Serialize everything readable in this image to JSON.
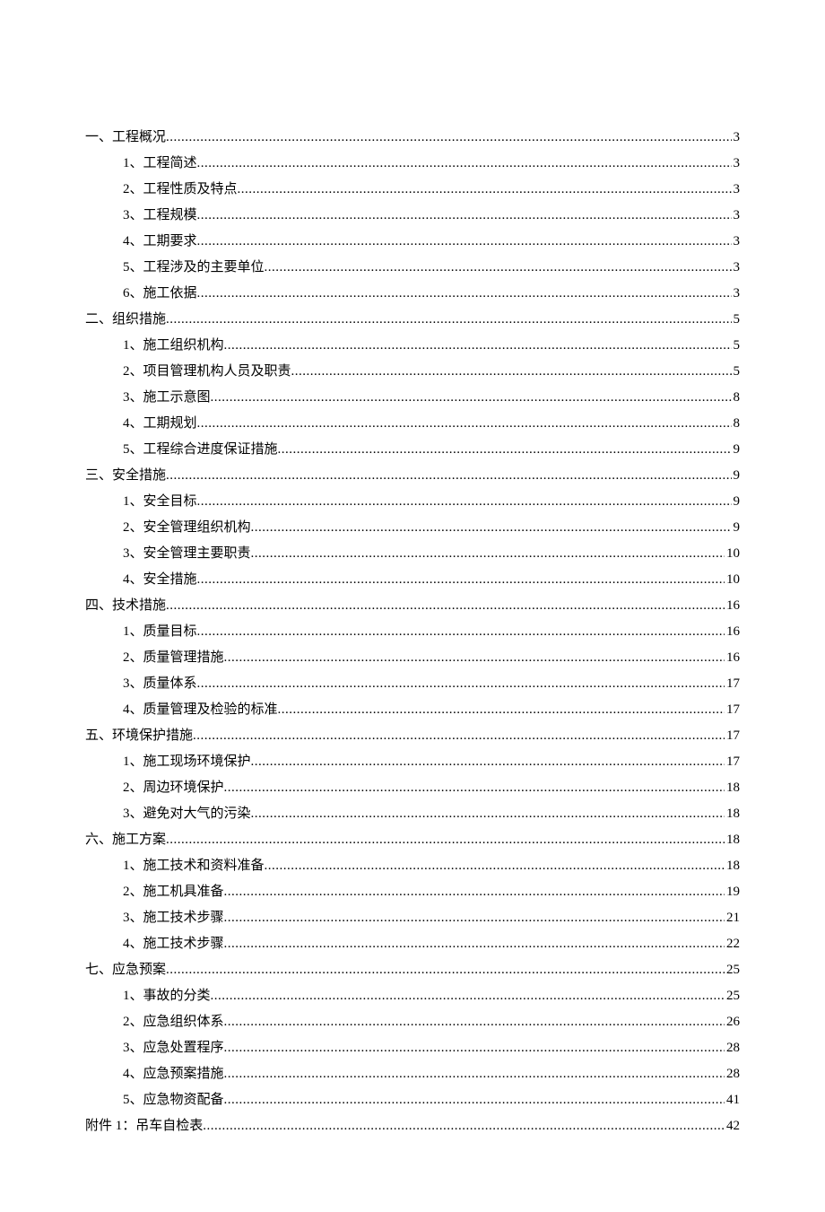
{
  "toc": [
    {
      "level": 0,
      "title": "一、工程概况",
      "page": "3"
    },
    {
      "level": 1,
      "title": "1、工程简述",
      "page": "3"
    },
    {
      "level": 1,
      "title": "2、工程性质及特点",
      "page": "3"
    },
    {
      "level": 1,
      "title": "3、工程规模",
      "page": "3"
    },
    {
      "level": 1,
      "title": "4、工期要求",
      "page": "3"
    },
    {
      "level": 1,
      "title": "5、工程涉及的主要单位",
      "page": "3"
    },
    {
      "level": 1,
      "title": "6、施工依据",
      "page": "3"
    },
    {
      "level": 0,
      "title": "二、组织措施",
      "page": "5"
    },
    {
      "level": 1,
      "title": "1、施工组织机构",
      "page": "5"
    },
    {
      "level": 1,
      "title": "2、项目管理机构人员及职责",
      "page": "5"
    },
    {
      "level": 1,
      "title": "3、施工示意图",
      "page": "8"
    },
    {
      "level": 1,
      "title": "4、工期规划",
      "page": "8"
    },
    {
      "level": 1,
      "title": "5、工程综合进度保证措施",
      "page": "9"
    },
    {
      "level": 0,
      "title": "三、安全措施",
      "page": "9"
    },
    {
      "level": 1,
      "title": "1、安全目标",
      "page": "9"
    },
    {
      "level": 1,
      "title": "2、安全管理组织机构",
      "page": "9"
    },
    {
      "level": 1,
      "title": "3、安全管理主要职责",
      "page": "10"
    },
    {
      "level": 1,
      "title": "4、安全措施",
      "page": "10"
    },
    {
      "level": 0,
      "title": "四、技术措施",
      "page": "16"
    },
    {
      "level": 1,
      "title": "1、质量目标",
      "page": "16"
    },
    {
      "level": 1,
      "title": "2、质量管理措施",
      "page": "16"
    },
    {
      "level": 1,
      "title": "3、质量体系",
      "page": "17"
    },
    {
      "level": 1,
      "title": "4、质量管理及检验的标准",
      "page": "17"
    },
    {
      "level": 0,
      "title": "五、环境保护措施",
      "page": "17"
    },
    {
      "level": 1,
      "title": "1、施工现场环境保护",
      "page": "17"
    },
    {
      "level": 1,
      "title": "2、周边环境保护",
      "page": "18"
    },
    {
      "level": 1,
      "title": "3、避免对大气的污染",
      "page": "18"
    },
    {
      "level": 0,
      "title": "六、施工方案",
      "page": "18"
    },
    {
      "level": 1,
      "title": "1、施工技术和资料准备",
      "page": "18"
    },
    {
      "level": 1,
      "title": "2、施工机具准备",
      "page": "19"
    },
    {
      "level": 1,
      "title": "3、施工技术步骤",
      "page": "21"
    },
    {
      "level": 1,
      "title": "4、施工技术步骤",
      "page": "22"
    },
    {
      "level": 0,
      "title": "七、应急预案",
      "page": "25"
    },
    {
      "level": 1,
      "title": "1、事故的分类",
      "page": "25"
    },
    {
      "level": 1,
      "title": "2、应急组织体系",
      "page": "26"
    },
    {
      "level": 1,
      "title": "3、应急处置程序",
      "page": "28"
    },
    {
      "level": 1,
      "title": "4、应急预案措施",
      "page": "28"
    },
    {
      "level": 1,
      "title": "5、应急物资配备",
      "page": "41"
    },
    {
      "level": 0,
      "title": "附件 1：吊车自检表 ",
      "page": "42"
    }
  ]
}
